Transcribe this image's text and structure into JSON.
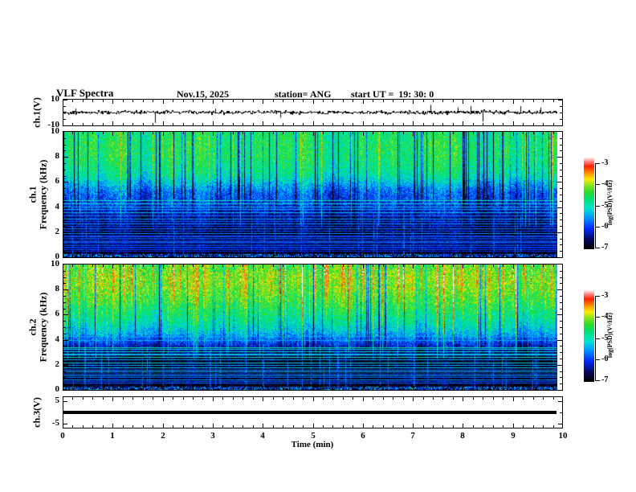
{
  "title": {
    "main": "VLF Spectra",
    "date": "Nov.15, 2025",
    "station": "station= ANG",
    "start_ut": "start UT =  19: 30: 0"
  },
  "xaxis": {
    "label": "Time (min)",
    "min": 0,
    "max": 10,
    "major_ticks": [
      "0",
      "1",
      "2",
      "3",
      "4",
      "5",
      "6",
      "7",
      "8",
      "9",
      "10"
    ],
    "minor_step_min": 0.2,
    "data_end_min": 9.83
  },
  "colorbar": {
    "label": "log(PSD)(V²/Hz)",
    "tick_labels": [
      "-3",
      "-4",
      "-5",
      "-6",
      "-7"
    ],
    "range": [
      -7,
      -3
    ]
  },
  "colormap_stops": [
    [
      0.0,
      0,
      0,
      0
    ],
    [
      0.1,
      8,
      8,
      90
    ],
    [
      0.22,
      0,
      40,
      255
    ],
    [
      0.34,
      0,
      150,
      255
    ],
    [
      0.44,
      0,
      230,
      210
    ],
    [
      0.54,
      0,
      225,
      120
    ],
    [
      0.62,
      40,
      220,
      40
    ],
    [
      0.7,
      150,
      230,
      30
    ],
    [
      0.76,
      255,
      235,
      0
    ],
    [
      0.83,
      255,
      140,
      0
    ],
    [
      0.9,
      255,
      30,
      0
    ],
    [
      0.95,
      255,
      130,
      130
    ],
    [
      1.0,
      255,
      255,
      255
    ]
  ],
  "chart_data": [
    {
      "id": "ch1_waveform",
      "type": "line",
      "ylabel": "ch.1(V)",
      "ylim": [
        -10,
        10
      ],
      "ytick_labels": [
        "10",
        "-10"
      ],
      "signal": "broadband noise of about ±2 V centered on 0 V for the full 9.83 min record",
      "noise_amp_v": 1.4,
      "seed": 42,
      "spikes_t_min_amp_v": [
        [
          0.25,
          3
        ],
        [
          1.85,
          -8
        ],
        [
          3.05,
          3
        ],
        [
          4.35,
          -4
        ],
        [
          7.35,
          6
        ],
        [
          7.9,
          4
        ],
        [
          8.15,
          5
        ],
        [
          8.4,
          -7
        ],
        [
          9.15,
          5
        ],
        [
          9.55,
          4
        ]
      ]
    },
    {
      "id": "ch1_spectrogram",
      "type": "heatmap",
      "ylabel_line1": "ch.1",
      "ylabel_line2": "Frequency (kHz)",
      "ylim_khz": [
        0,
        10
      ],
      "yticks_khz": [
        10,
        8,
        6,
        4,
        2,
        0
      ],
      "ytick_labels": [
        "10",
        "8",
        "6",
        "4",
        "2",
        "0"
      ],
      "minor_step_khz": 0.5,
      "seed": 7,
      "base_profile_khz_logpsd": [
        [
          0,
          -6.95
        ],
        [
          0.8,
          -6.9
        ],
        [
          1.8,
          -6.85
        ],
        [
          2.9,
          -6.6
        ],
        [
          3.4,
          -6.45
        ],
        [
          4.0,
          -6.2
        ],
        [
          4.6,
          -6.0
        ],
        [
          5.2,
          -5.9
        ],
        [
          5.8,
          -5.55
        ],
        [
          6.4,
          -5.15
        ],
        [
          7.0,
          -4.95
        ],
        [
          8.0,
          -4.8
        ],
        [
          9.0,
          -4.75
        ],
        [
          10,
          -4.85
        ]
      ],
      "harmonic_lines_khz_logpsd": [
        [
          4.55,
          -5.1
        ],
        [
          4.3,
          -5.25
        ],
        [
          4.05,
          -5.5
        ],
        [
          3.85,
          -5.6
        ],
        [
          3.6,
          -5.5
        ],
        [
          3.35,
          -5.8
        ],
        [
          3.1,
          -5.6
        ],
        [
          2.9,
          -5.9
        ],
        [
          2.7,
          -5.7
        ],
        [
          2.5,
          -6.0
        ],
        [
          2.3,
          -5.8
        ],
        [
          2.1,
          -6.0
        ],
        [
          1.9,
          -5.7
        ],
        [
          1.7,
          -6.0
        ],
        [
          1.55,
          -5.9
        ],
        [
          1.4,
          -6.1
        ],
        [
          1.25,
          -5.9
        ],
        [
          1.1,
          -6.1
        ],
        [
          0.95,
          -5.9
        ],
        [
          0.8,
          -6.1
        ],
        [
          0.65,
          -6.0
        ],
        [
          0.5,
          -6.2
        ]
      ],
      "streaks": {
        "dark_prob": 0.1,
        "dark_strength": [
          0.7,
          2.0
        ],
        "dark_min_khz": 3.5,
        "bright_prob": 0.05,
        "bright_strength": [
          0.3,
          0.9
        ],
        "lower_cyan_prob": 0.05,
        "red_prob": 0,
        "red_strength": [
          0,
          0
        ],
        "red_min_khz": 10
      }
    },
    {
      "id": "ch2_spectrogram",
      "type": "heatmap",
      "ylabel_line1": "ch.2",
      "ylabel_line2": "Frequency (kHz)",
      "ylim_khz": [
        0,
        10
      ],
      "yticks_khz": [
        10,
        8,
        6,
        4,
        2,
        0
      ],
      "ytick_labels": [
        "10",
        "8",
        "6",
        "4",
        "2",
        "0"
      ],
      "minor_step_khz": 0.5,
      "seed": 13,
      "base_profile_khz_logpsd": [
        [
          0,
          -6.95
        ],
        [
          0.9,
          -6.9
        ],
        [
          1.6,
          -6.8
        ],
        [
          2.4,
          -6.85
        ],
        [
          3.2,
          -6.5
        ],
        [
          3.7,
          -6.15
        ],
        [
          4.2,
          -5.75
        ],
        [
          4.8,
          -5.35
        ],
        [
          5.5,
          -5.05
        ],
        [
          6.2,
          -4.85
        ],
        [
          7.0,
          -4.6
        ],
        [
          8.0,
          -4.4
        ],
        [
          9.0,
          -4.3
        ],
        [
          10,
          -4.5
        ]
      ],
      "harmonic_lines_khz_logpsd": [
        [
          4.6,
          -5.8
        ],
        [
          4.3,
          -5.7
        ],
        [
          4.0,
          -5.6
        ],
        [
          3.4,
          -5.0
        ],
        [
          3.25,
          -5.35
        ],
        [
          3.05,
          -5.2
        ],
        [
          2.85,
          -5.45
        ],
        [
          2.65,
          -5.15
        ],
        [
          2.45,
          -5.5
        ],
        [
          2.2,
          -5.3
        ],
        [
          2.0,
          -5.6
        ],
        [
          1.8,
          -5.4
        ],
        [
          1.6,
          -5.7
        ],
        [
          1.45,
          -5.5
        ],
        [
          1.3,
          -5.8
        ],
        [
          1.15,
          -5.6
        ],
        [
          1.0,
          -5.9
        ],
        [
          0.85,
          -5.7
        ],
        [
          0.7,
          -6.0
        ],
        [
          0.55,
          -5.9
        ]
      ],
      "streaks": {
        "dark_prob": 0.07,
        "dark_strength": [
          0.5,
          1.7
        ],
        "dark_min_khz": 3.2,
        "bright_prob": 0.09,
        "bright_strength": [
          0.3,
          1.0
        ],
        "lower_cyan_prob": 0.06,
        "red_prob": 0.1,
        "red_strength": [
          0.7,
          1.6
        ],
        "red_min_khz": 5.0
      }
    },
    {
      "id": "ch3_waveform",
      "type": "line",
      "ylabel": "ch.3(V)",
      "ylim": [
        -6.67,
        6.67
      ],
      "ytick_labels": [
        "5",
        "-5"
      ],
      "signal": "constant 0 V (flat thick line) for the full 9.83 min record",
      "constant_value_v": 0,
      "line_thickness_px": 4
    }
  ]
}
